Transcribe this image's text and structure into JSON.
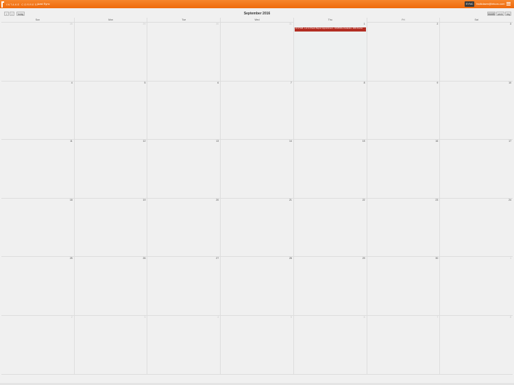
{
  "header": {
    "logo_text": "INTAKE CORRESP",
    "nav_link": "Last Sync",
    "sync_label": "SYNC",
    "user_email": "hsdkdawn@intuos.com"
  },
  "toolbar": {
    "prev_label": "‹",
    "next_label": "›",
    "today_label": "today",
    "title": "September 2016",
    "views": [
      "month",
      "week",
      "day"
    ]
  },
  "calendar": {
    "weekdays": [
      "Sun",
      "Mon",
      "Tue",
      "Wed",
      "Thu",
      "Fri",
      "Sat"
    ],
    "weeks": [
      [
        "28",
        "29",
        "30",
        "31",
        "1",
        "2",
        "3"
      ],
      [
        "4",
        "5",
        "6",
        "7",
        "8",
        "9",
        "10"
      ],
      [
        "11",
        "12",
        "13",
        "14",
        "15",
        "16",
        "17"
      ],
      [
        "18",
        "19",
        "20",
        "21",
        "22",
        "23",
        "24"
      ],
      [
        "25",
        "26",
        "27",
        "28",
        "29",
        "30",
        "1"
      ],
      [
        "2",
        "3",
        "4",
        "5",
        "6",
        "7",
        "8"
      ]
    ],
    "event": {
      "title": "10:27AM - Lol to Check Report Appointment - 10/2016to Outlands / 30th Doctor"
    },
    "colors": {
      "header": "#f47a1f",
      "event": "#b22d22"
    }
  }
}
